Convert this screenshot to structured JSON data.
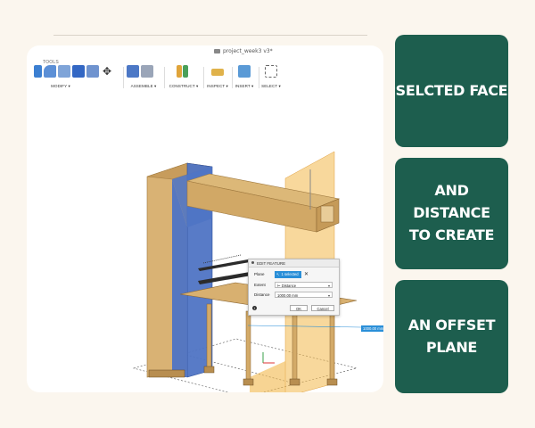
{
  "window": {
    "doc_title": "project_week3 v3*"
  },
  "toolbar": {
    "tools_label": "TOOLS",
    "groups": [
      {
        "label": "MODIFY ▾"
      },
      {
        "label": "ASSEMBLE ▾"
      },
      {
        "label": "CONSTRUCT ▾"
      },
      {
        "label": "INSPECT ▾"
      },
      {
        "label": "INSERT ▾"
      },
      {
        "label": "SELECT ▾"
      }
    ]
  },
  "dialog": {
    "title": "EDIT FEATURE",
    "plane_label": "Plane",
    "plane_value": "1 selected",
    "clear_glyph": "✕",
    "extent_label": "Extent",
    "extent_value": "Distance",
    "distance_label": "Distance",
    "distance_value": "1000.00 mm",
    "info_glyph": "i",
    "ok_label": "OK",
    "cancel_label": "Cancel"
  },
  "viewport": {
    "distance_tag": "1000.00 mm"
  },
  "cards": [
    {
      "text": "SELCTED FACE"
    },
    {
      "text": "AND DISTANCE\nTO CREATE"
    },
    {
      "text": "AN OFFSET\nPLANE"
    }
  ],
  "colors": {
    "card_bg": "#1d5e4e",
    "page_bg": "#fbf6ee",
    "wood": "#d9b274",
    "selected_face": "#4f74c4",
    "offset_plane": "#f2b84b",
    "accent": "#2a8fd8"
  }
}
